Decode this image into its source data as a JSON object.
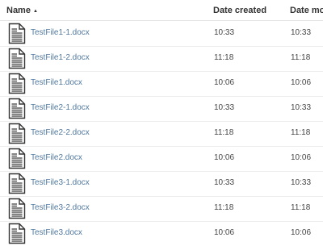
{
  "columns": {
    "name": "Name",
    "created": "Date created",
    "modified": "Date modi"
  },
  "files": [
    {
      "name": "TestFile1-1.docx",
      "created": "10:33",
      "modified": "10:33"
    },
    {
      "name": "TestFile1-2.docx",
      "created": "11:18",
      "modified": "11:18"
    },
    {
      "name": "TestFile1.docx",
      "created": "10:06",
      "modified": "10:06"
    },
    {
      "name": "TestFile2-1.docx",
      "created": "10:33",
      "modified": "10:33"
    },
    {
      "name": "TestFile2-2.docx",
      "created": "11:18",
      "modified": "11:18"
    },
    {
      "name": "TestFile2.docx",
      "created": "10:06",
      "modified": "10:06"
    },
    {
      "name": "TestFile3-1.docx",
      "created": "10:33",
      "modified": "10:33"
    },
    {
      "name": "TestFile3-2.docx",
      "created": "11:18",
      "modified": "11:18"
    },
    {
      "name": "TestFile3.docx",
      "created": "10:06",
      "modified": "10:06"
    }
  ],
  "colors": {
    "link": "#51799f",
    "text": "#333333",
    "border": "#e4e4e4"
  },
  "icons": {
    "file": "document-icon",
    "sort": "sort-ascending-icon"
  }
}
